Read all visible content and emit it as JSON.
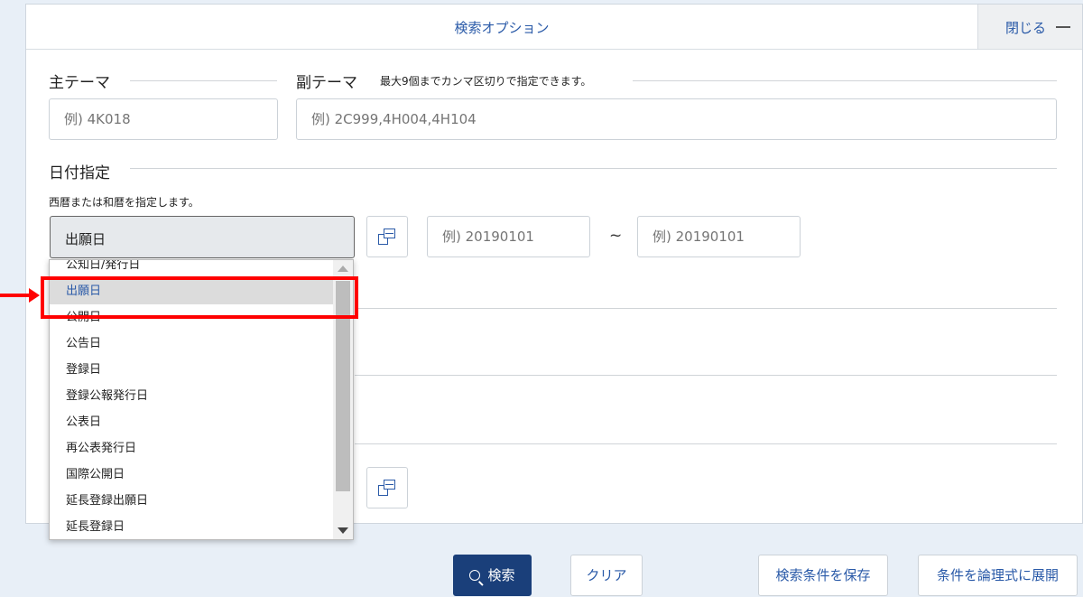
{
  "panel": {
    "title": "検索オプション",
    "close_label": "閉じる"
  },
  "main_theme": {
    "label": "主テーマ",
    "placeholder": "例) 4K018"
  },
  "sub_theme": {
    "label": "副テーマ",
    "hint": "最大9個までカンマ区切りで指定できます。",
    "placeholder": "例) 2C999,4H004,4H104"
  },
  "date": {
    "label": "日付指定",
    "hint": "西暦または和暦を指定します。",
    "selected": "出願日",
    "from_placeholder": "例) 20190101",
    "separator": "~",
    "to_placeholder": "例) 20190101"
  },
  "dropdown_options": [
    "公知日/発行日",
    "出願日",
    "公開日",
    "公告日",
    "登録日",
    "登録公報発行日",
    "公表日",
    "再公表発行日",
    "国際公開日",
    "延長登録出願日",
    "延長登録日"
  ],
  "buttons": {
    "search": "検索",
    "clear": "クリア",
    "save": "検索条件を保存",
    "expand": "条件を論理式に展開"
  },
  "colors": {
    "accent": "#2a5aa8",
    "primary_button": "#1a3f7a",
    "highlight": "#ff0000"
  }
}
